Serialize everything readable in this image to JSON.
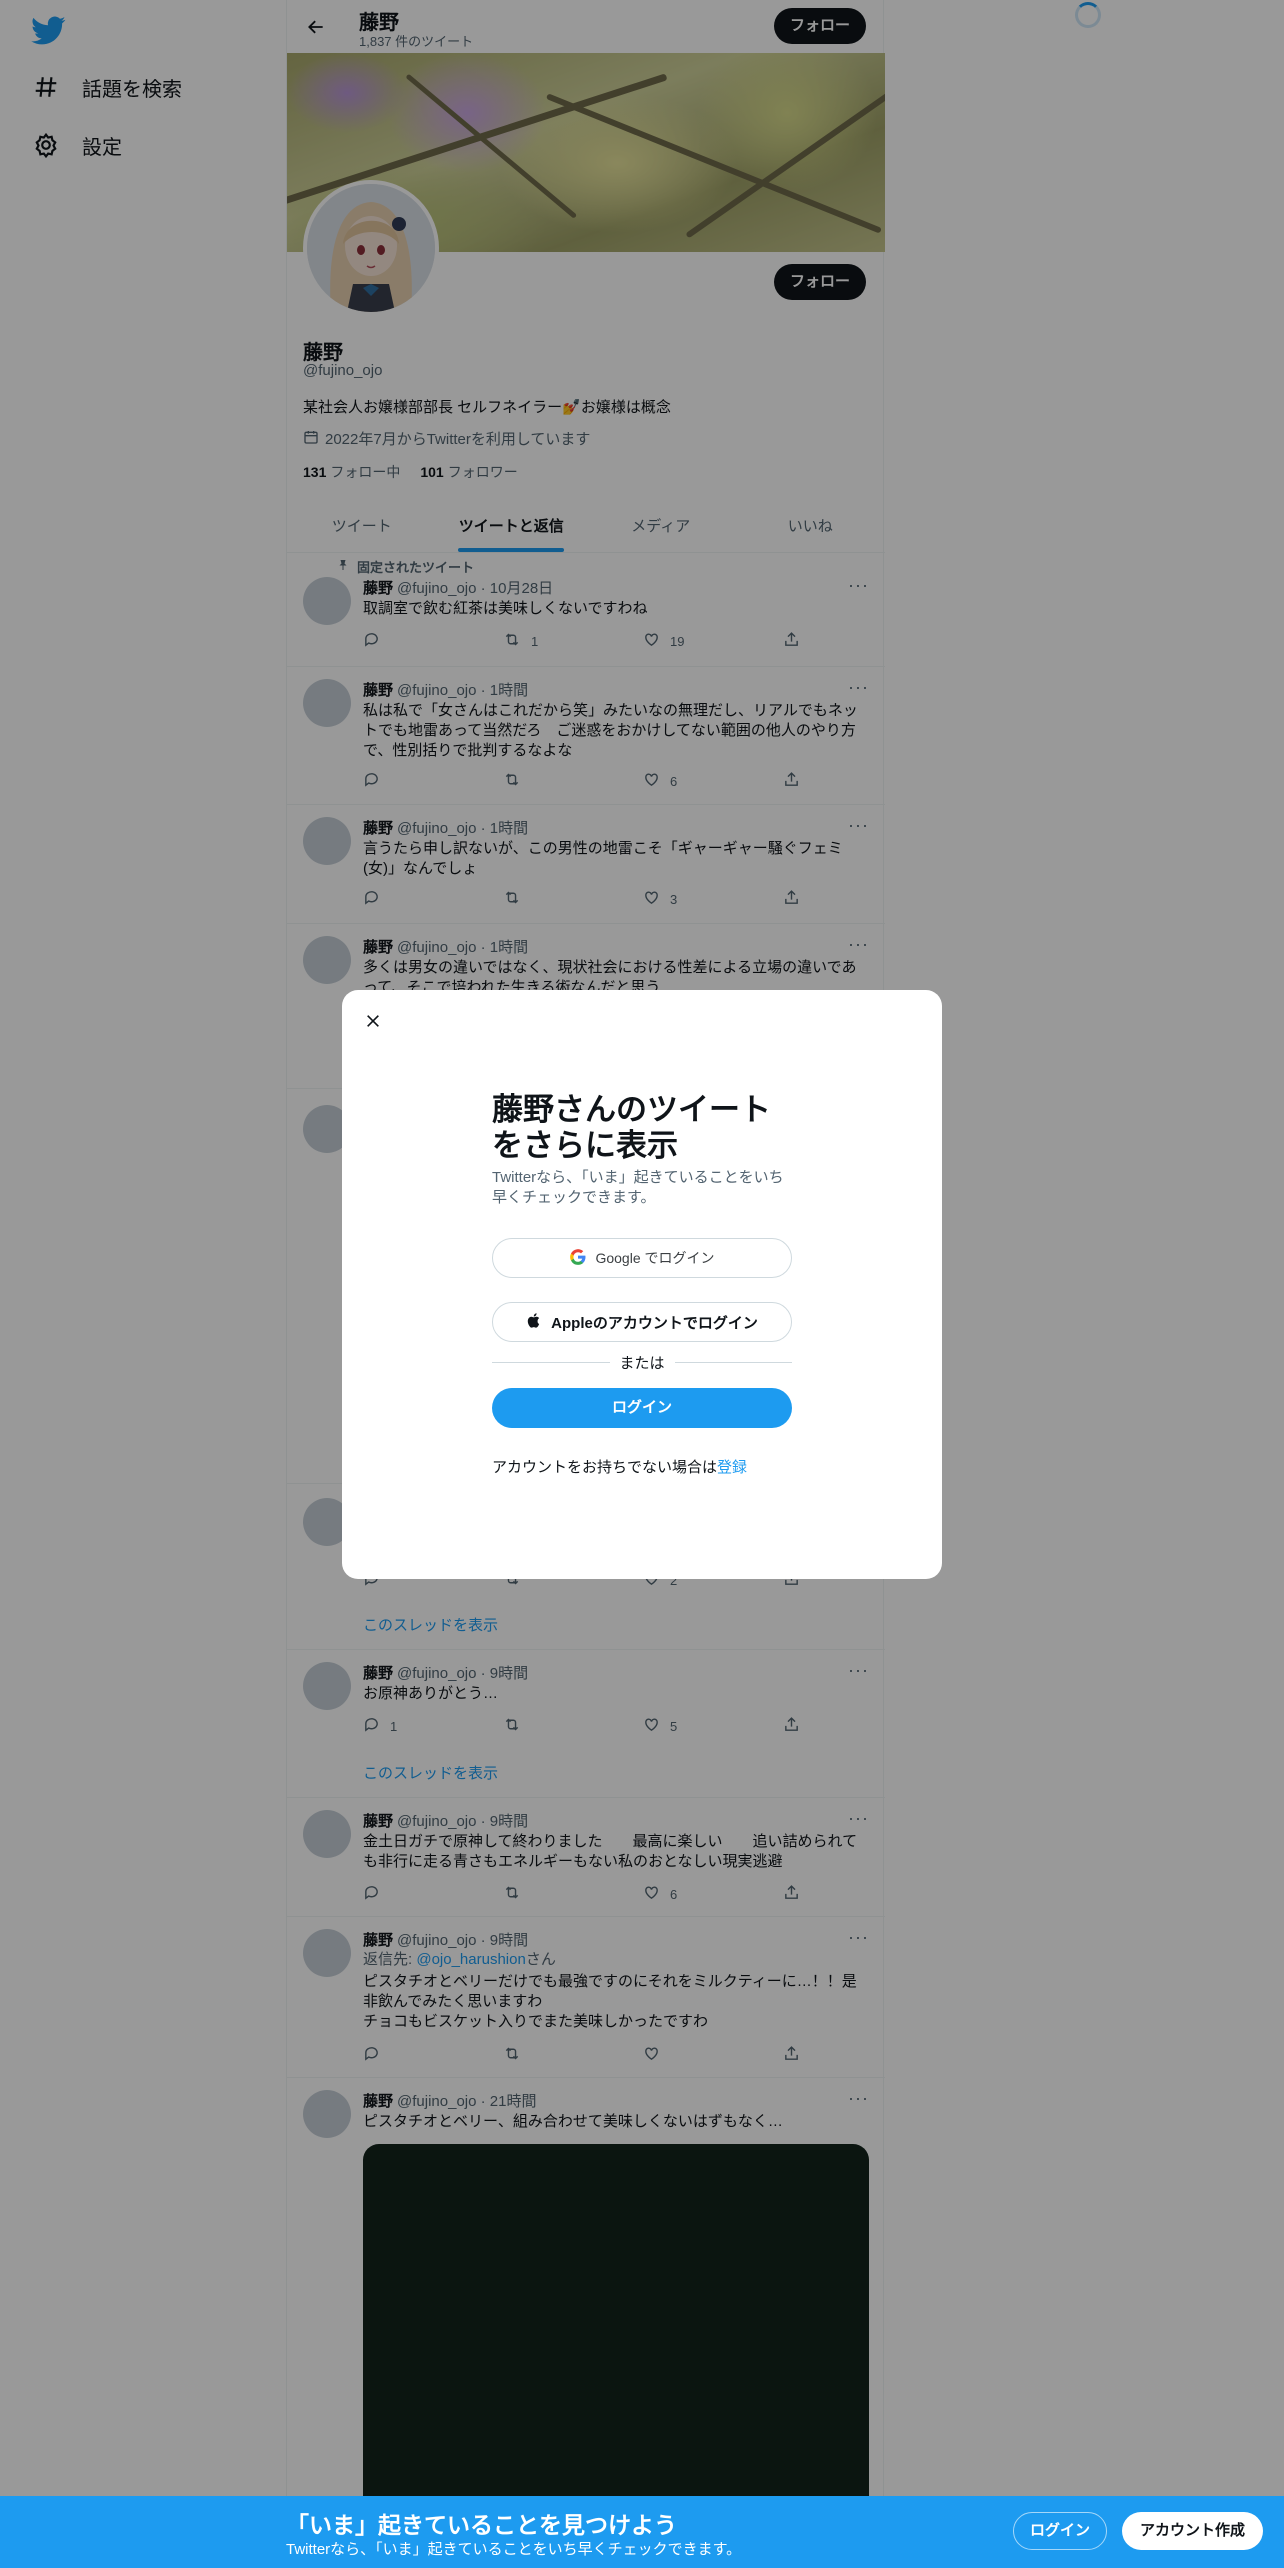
{
  "nav": {
    "explore_label": "話題を検索",
    "settings_label": "設定"
  },
  "header": {
    "name": "藤野",
    "tweet_count": "1,837 件のツイート",
    "follow_label": "フォロー"
  },
  "profile": {
    "name": "藤野",
    "handle": "@fujino_ojo",
    "bio": "某社会人お嬢様部部長 セルフネイラー💅お嬢様は概念",
    "joined": "2022年7月からTwitterを利用しています",
    "following_count": "131",
    "following_label": "フォロー中",
    "followers_count": "101",
    "followers_label": "フォロワー",
    "follow_label": "フォロー"
  },
  "tabs": [
    "ツイート",
    "ツイートと返信",
    "メディア",
    "いいね"
  ],
  "tweets": [
    {
      "pinned": "固定されたツイート",
      "name": "藤野",
      "meta": "@fujino_ojo · 10月28日",
      "text": "取調室で飲む紅茶は美味しくないですわね",
      "replies": "",
      "retweets": "1",
      "likes": "19"
    },
    {
      "name": "藤野",
      "meta": "@fujino_ojo · 1時間",
      "text": "私は私で「女さんはこれだから笑」みたいなの無理だし、リアルでもネットでも地雷あって当然だろ　ご迷惑をおかけしてない範囲の他人のやり方で、性別括りで批判するなよな",
      "replies": "",
      "retweets": "",
      "likes": "6"
    },
    {
      "name": "藤野",
      "meta": "@fujino_ojo · 1時間",
      "text": "言うたら申し訳ないが、この男性の地雷こそ「ギャーギャー騒ぐフェミ(女)」なんでしょ",
      "replies": "",
      "retweets": "",
      "likes": "3"
    },
    {
      "name": "藤野",
      "meta": "@fujino_ojo · 1時間",
      "text": "多くは男女の違いではなく、現状社会における性差による立場の違いであって、そこで培われた生きる術なんだと思う"
    },
    {
      "likes": "2",
      "thread": "このスレッドを表示"
    },
    {
      "name": "藤野",
      "meta": "@fujino_ojo · 9時間",
      "text": "お原神ありがとう…",
      "replies": "1",
      "retweets": "",
      "likes": "5",
      "thread": "このスレッドを表示"
    },
    {
      "name": "藤野",
      "meta": "@fujino_ojo · 9時間",
      "text": "金土日ガチで原神して終わりました　　最高に楽しい　　追い詰められても非行に走る青さもエネルギーもない私のおとなしい現実逃避",
      "replies": "",
      "retweets": "",
      "likes": "6"
    },
    {
      "name": "藤野",
      "meta": "@fujino_ojo · 9時間",
      "reply_prefix": "返信先: ",
      "reply_handle": "@ojo_harushion",
      "reply_suffix": "さん",
      "text1": "ピスタチオとベリーだけでも最強ですのにそれをミルクティーに…！！是非飲んでみたく思いますわ",
      "text2": "チョコもビスケット入りでまた美味しかったですわ",
      "replies": "",
      "retweets": "",
      "likes": ""
    },
    {
      "name": "藤野",
      "meta": "@fujino_ojo · 21時間",
      "text": "ピスタチオとベリー、組み合わせて美味しくないはずもなく…"
    }
  ],
  "modal": {
    "title": "藤野さんのツイートをさらに表示",
    "subtitle": "Twitterなら、「いま」起きていることをいち早くチェックできます。",
    "google_label": "Google でログイン",
    "apple_label": "Appleのアカウントでログイン",
    "or_label": "または",
    "login_label": "ログイン",
    "signup_prefix": "アカウントをお持ちでない場合は",
    "signup_link": "登録"
  },
  "bottombar": {
    "title": "「いま」起きていることを見つけよう",
    "subtitle": "Twitterなら、「いま」起きていることをいち早くチェックできます。",
    "login_label": "ログイン",
    "signup_label": "アカウント作成"
  },
  "colors": {
    "accent": "#1d9bf0",
    "text": "#0f1419",
    "muted": "#536471"
  }
}
